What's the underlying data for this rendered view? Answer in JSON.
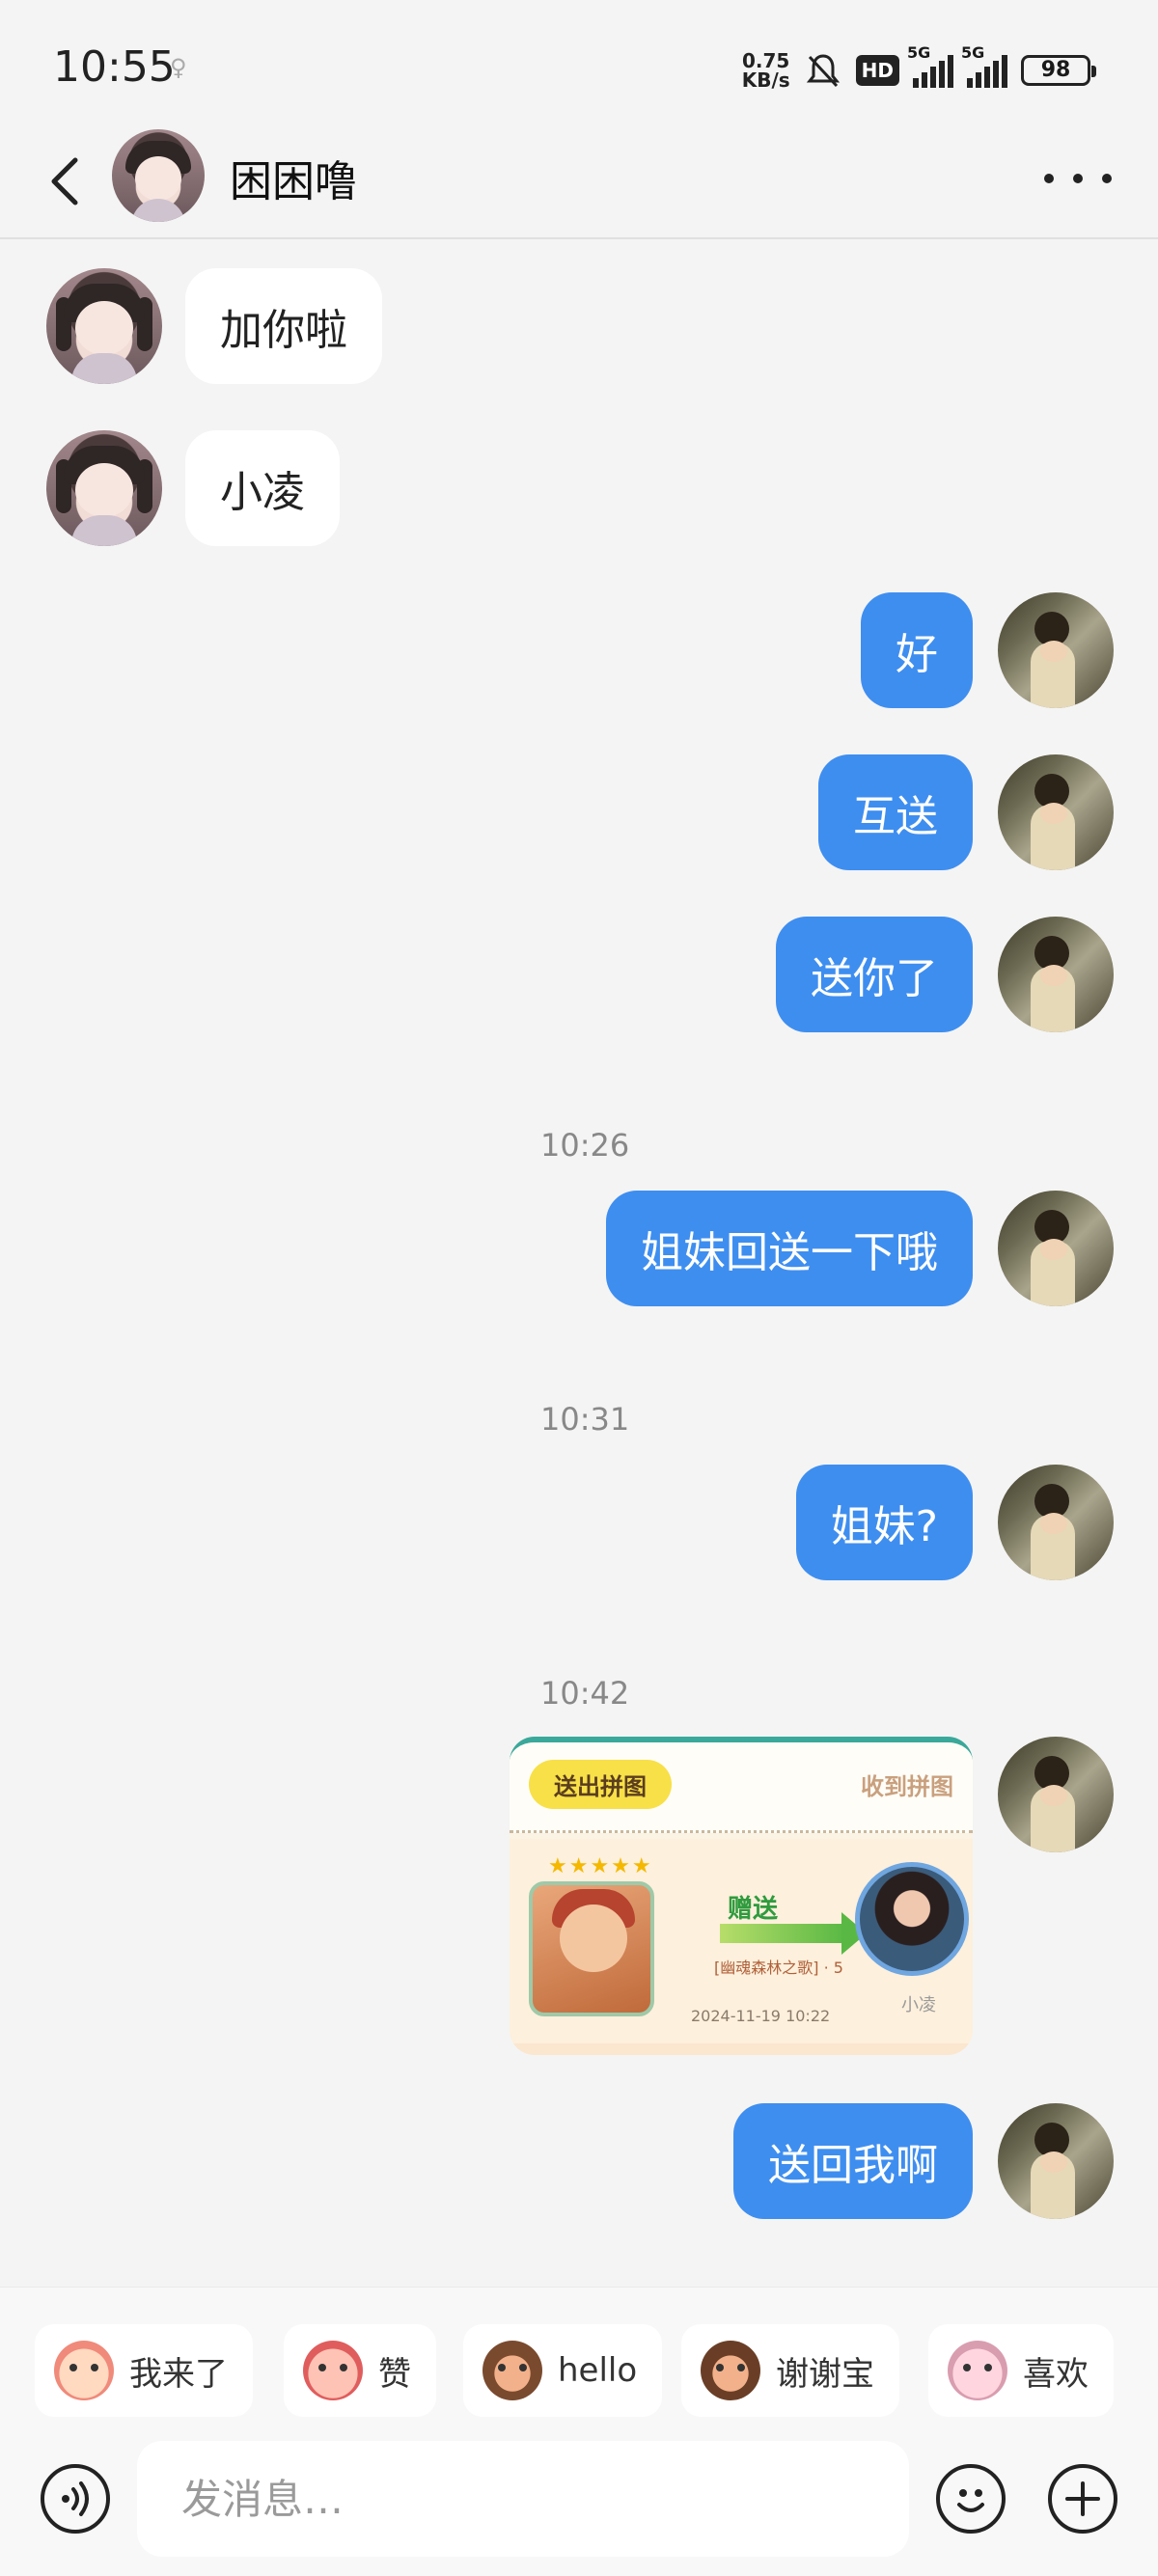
{
  "status_bar": {
    "time": "10:55",
    "net_speed_value": "0.75",
    "net_speed_unit": "KB/s",
    "hd_label": "HD",
    "sim1_label": "5G",
    "sim2_label": "5G",
    "battery": "98"
  },
  "header": {
    "title": "困困噜",
    "back_icon": "chevron-left-icon",
    "more_icon": "more-dots-icon"
  },
  "messages": [
    {
      "side": "in",
      "text": "加你啦"
    },
    {
      "side": "in",
      "text": "小凌"
    },
    {
      "side": "out",
      "text": "好"
    },
    {
      "side": "out",
      "text": "互送"
    },
    {
      "side": "out",
      "text": "送你了"
    },
    {
      "timestamp": "10:26"
    },
    {
      "side": "out",
      "text": "姐妹回送一下哦"
    },
    {
      "timestamp": "10:31"
    },
    {
      "side": "out",
      "text": "姐妹?"
    },
    {
      "timestamp": "10:42"
    },
    {
      "side": "out",
      "type": "card"
    },
    {
      "side": "out",
      "text": "送回我啊"
    }
  ],
  "timestamps": [
    "10:26",
    "10:31",
    "10:42"
  ],
  "puzzle_card": {
    "send_tag": "送出拼图",
    "receive_tag": "收到拼图",
    "gift_word": "赠送",
    "puzzle_name": "[幽魂森林之歌] · 5",
    "date": "2024-11-19 10:22",
    "recipient": "小凌",
    "stars": "★★★★★"
  },
  "quick_replies": [
    {
      "label": "我来了",
      "icon": "sticker-wave-icon"
    },
    {
      "label": "赞",
      "icon": "sticker-thumbs-icon"
    },
    {
      "label": "hello",
      "icon": "sticker-monkey-icon"
    },
    {
      "label": "谢谢宝",
      "icon": "sticker-thanks-icon"
    },
    {
      "label": "喜欢",
      "icon": "sticker-love-icon"
    }
  ],
  "input": {
    "placeholder": "发消息…",
    "voice_icon": "voice-icon",
    "emoji_icon": "emoji-icon",
    "plus_icon": "plus-icon"
  },
  "colors": {
    "outgoing_bubble": "#3e8ef0",
    "incoming_bubble": "#ffffff",
    "background": "#f4f4f4"
  }
}
